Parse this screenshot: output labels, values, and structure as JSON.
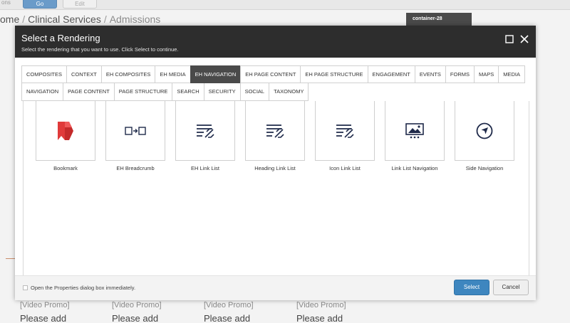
{
  "background": {
    "topbar_fragment": "ons",
    "go_button": "Go",
    "edit_button": "Edit",
    "breadcrumb": {
      "home": "ome",
      "section": "Clinical Services",
      "current": "Admissions"
    },
    "chip_label": "container-28",
    "promos": [
      {
        "tag": "[Video Promo]",
        "text": "Please add"
      },
      {
        "tag": "[Video Promo]",
        "text": "Please add"
      },
      {
        "tag": "[Video Promo]",
        "text": "Please add"
      },
      {
        "tag": "[Video Promo]",
        "text": "Please add"
      }
    ]
  },
  "dialog": {
    "title": "Select a Rendering",
    "subtitle": "Select the rendering that you want to use. Click Select to continue.",
    "tabs_row1": [
      "COMPOSITES",
      "CONTEXT",
      "EH COMPOSITES",
      "EH MEDIA",
      "EH NAVIGATION",
      "EH PAGE CONTENT",
      "EH PAGE STRUCTURE",
      "ENGAGEMENT",
      "EVENTS",
      "FORMS",
      "MAPS",
      "MEDIA"
    ],
    "tabs_row2": [
      "NAVIGATION",
      "PAGE CONTENT",
      "PAGE STRUCTURE",
      "SEARCH",
      "SECURITY",
      "SOCIAL",
      "TAXONOMY"
    ],
    "active_tab": "EH NAVIGATION",
    "renderings": [
      {
        "label": "Bookmark",
        "icon": "bookmark-icon"
      },
      {
        "label": "EH Breadcrumb",
        "icon": "breadcrumb-icon"
      },
      {
        "label": "EH Link List",
        "icon": "link-list-icon"
      },
      {
        "label": "Heading Link List",
        "icon": "link-list-icon"
      },
      {
        "label": "Icon Link List",
        "icon": "link-list-icon"
      },
      {
        "label": "Link List Navigation",
        "icon": "image-navigation-icon"
      },
      {
        "label": "Side Navigation",
        "icon": "compass-navigation-icon"
      }
    ],
    "footer": {
      "checkbox_label": "Open the Properties dialog box immediately.",
      "select_label": "Select",
      "cancel_label": "Cancel"
    }
  },
  "colors": {
    "header_bg": "#2d2d2d",
    "active_tab_bg": "#4a4a4a",
    "primary_button": "#3e86bf",
    "icon_navy": "#1f2a4a",
    "bookmark_red": "#e03a3a"
  }
}
